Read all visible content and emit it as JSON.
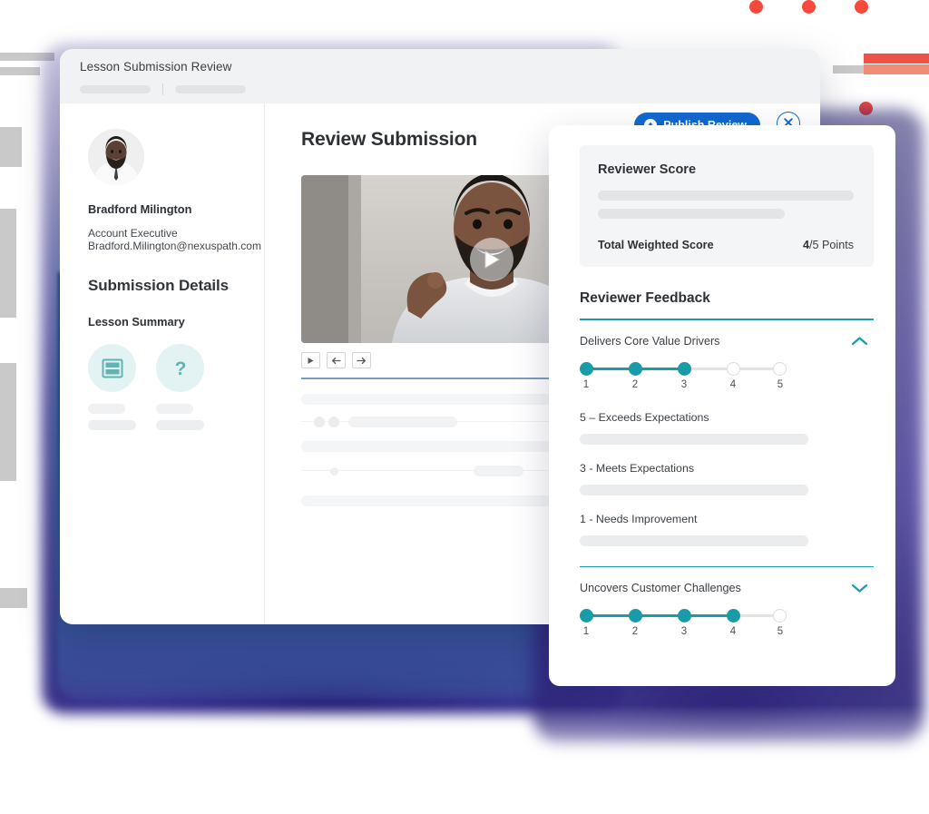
{
  "window": {
    "title": "Lesson Submission Review",
    "publish_button": {
      "label": "Publish Review",
      "icon": "upload-circle-icon",
      "color": "#1169cf"
    },
    "close_button": {
      "icon": "close-icon"
    }
  },
  "sidebar": {
    "avatar_alt": "user-avatar",
    "name": "Bradford Milington",
    "role": "Account Executive",
    "email": "Bradford.Milington@nexuspath.com",
    "section_title": "Submission Details",
    "subsection_title": "Lesson Summary",
    "summary_icons": [
      {
        "icon": "layout-card-icon"
      },
      {
        "icon": "question-mark-icon"
      }
    ]
  },
  "main": {
    "heading": "Review Submission",
    "video": {
      "play_icon": "play-icon"
    },
    "video_controls": [
      {
        "icon": "play-small-icon"
      },
      {
        "icon": "arrow-left-icon"
      },
      {
        "icon": "arrow-right-icon"
      }
    ]
  },
  "review_panel": {
    "score_card": {
      "title": "Reviewer Score",
      "total_label": "Total Weighted Score",
      "total_value": "4",
      "total_suffix": "/5 Points"
    },
    "feedback_title": "Reviewer Feedback",
    "criteria": [
      {
        "label": "Delivers Core Value Drivers",
        "expanded": true,
        "chevron": "chevron-up-icon",
        "scale": [
          "1",
          "2",
          "3",
          "4",
          "5"
        ],
        "value": 3,
        "expectations": [
          {
            "label": "5 – Exceeds Expectations"
          },
          {
            "label": "3 - Meets Expectations"
          },
          {
            "label": "1 - Needs Improvement"
          }
        ]
      },
      {
        "label": "Uncovers Customer Challenges",
        "expanded": false,
        "chevron": "chevron-down-icon",
        "scale": [
          "1",
          "2",
          "3",
          "4",
          "5"
        ],
        "value": 4,
        "expectations": []
      }
    ]
  },
  "theme": {
    "accent_teal": "#1a9ba8",
    "accent_blue": "#1169cf",
    "decor_red": "#f5493d",
    "decor_coral": "#ef8d79"
  }
}
